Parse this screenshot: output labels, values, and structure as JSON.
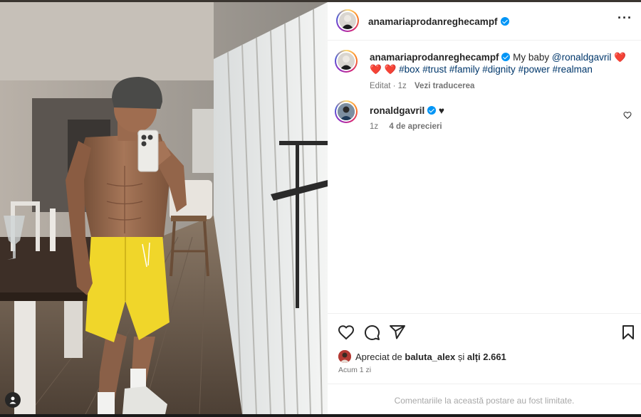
{
  "post": {
    "author": "anamariaprodanreghecampf",
    "caption_prefix": "My baby",
    "mention": "@ronaldgavril",
    "hearts_1": "❤️ ❤️",
    "hearts_2": "❤️",
    "hashtags": [
      "#box",
      "#trust",
      "#family",
      "#dignity",
      "#power",
      "#realman"
    ],
    "edited_label": "Editat",
    "caption_time": "1z",
    "translate_label": "Vezi traducerea"
  },
  "comment": {
    "author": "ronaldgavril",
    "text": "♥",
    "time": "1z",
    "likes_label": "4 de aprecieri"
  },
  "likes": {
    "prefix": "Apreciat de",
    "user": "baluta_alex",
    "suffix": "și",
    "others": "alți 2.661",
    "time_label": "Acum 1 zi"
  },
  "comments_limited": "Comentariile la această postare au fost limitate.",
  "icons": [
    "heart-icon",
    "comment-icon",
    "share-icon",
    "bookmark-icon",
    "more-icon",
    "verified-badge-icon",
    "story-icon"
  ],
  "colors": {
    "accent": "#0095f6",
    "link": "#00376b",
    "muted": "#737373",
    "heart": "#e0152f"
  }
}
